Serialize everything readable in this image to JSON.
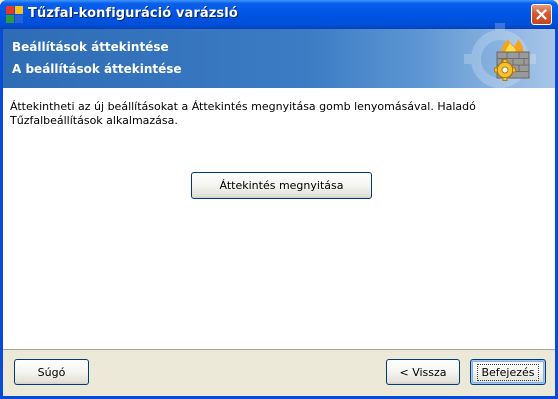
{
  "window": {
    "title": "Tűzfal-konfiguráció varázsló",
    "close_icon": "close-icon"
  },
  "header": {
    "title": "Beállítások áttekintése",
    "subtitle": "A beállítások áttekintése",
    "logo_icon": "firewall-gear-icon"
  },
  "main": {
    "description": "Áttekintheti az új beállításokat a Áttekintés megnyitása gomb lenyomásával. Haladó Tűzfalbeállítások alkalmazása.",
    "review_button_label": "Áttekintés megnyitása"
  },
  "footer": {
    "help_label": "Súgó",
    "back_label": "< Vissza",
    "finish_label": "Befejezés"
  },
  "colors": {
    "titlebar": "#0054E3",
    "header_gradient_start": "#2E6CB6",
    "header_gradient_end": "#A8C6E8",
    "window_face": "#ECE9D8"
  }
}
